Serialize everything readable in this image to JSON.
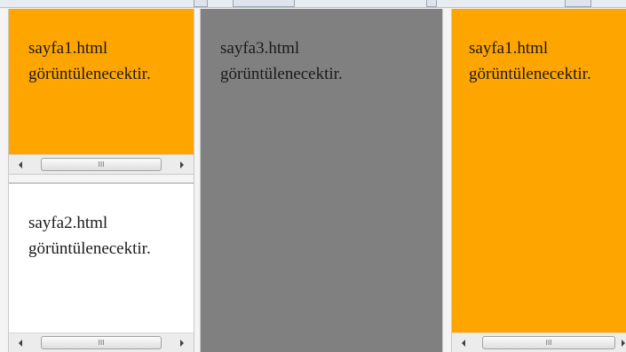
{
  "frames": {
    "top_left": {
      "line1": "sayfa1.html",
      "line2": "görüntülenecektir."
    },
    "bottom_left": {
      "line1": "sayfa2.html",
      "line2": "görüntülenecektir."
    },
    "middle": {
      "line1": "sayfa3.html",
      "line2": "görüntülenecektir."
    },
    "right": {
      "line1": "sayfa1.html",
      "line2": "görüntülenecektir."
    }
  },
  "scrollbars": {
    "grip_glyph": "III"
  },
  "colors": {
    "orange_frame": "#ffa500",
    "white_frame": "#ffffff",
    "gray_frame": "#808080",
    "frame_border": "#f4f4f4"
  },
  "icons": [
    "scroll-left-arrow-icon",
    "scroll-right-arrow-icon",
    "scroll-grip-icon"
  ]
}
